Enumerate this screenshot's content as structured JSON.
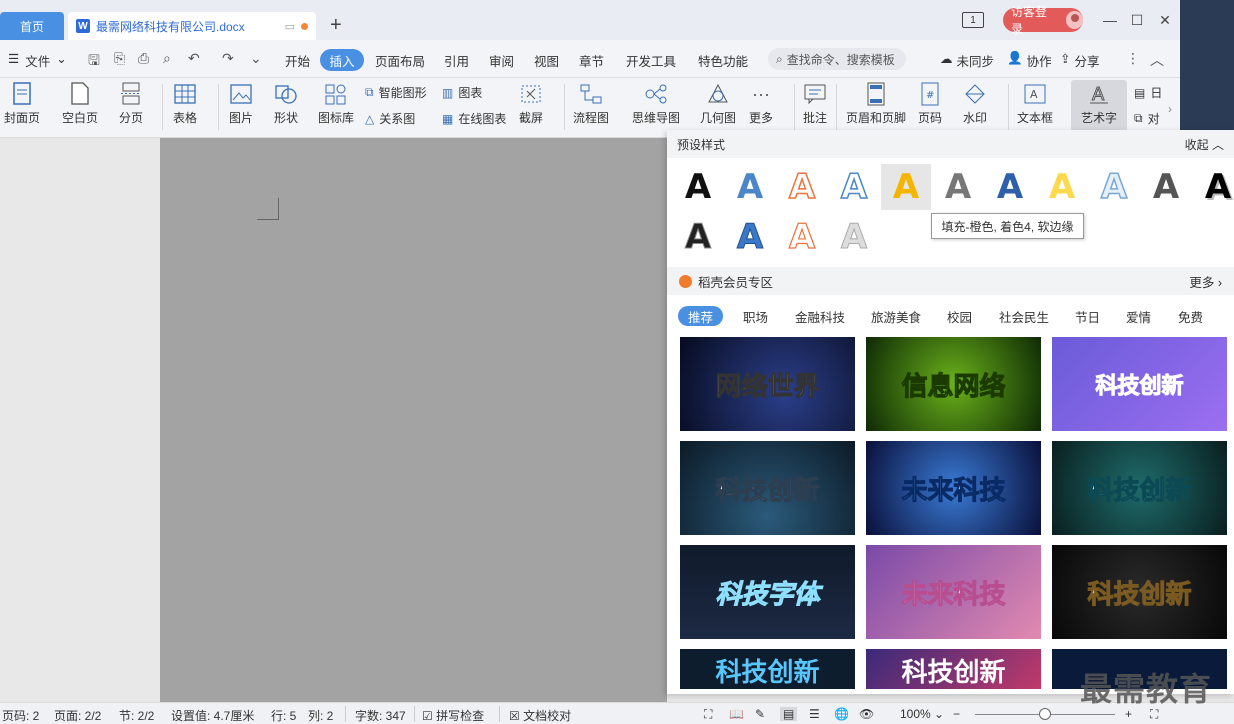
{
  "titlebar": {
    "home_tab": "首页",
    "doc_tab": "最需网络科技有限公司.docx",
    "page_badge": "1",
    "guest_login": "访客登录"
  },
  "menu": {
    "file": "文件",
    "tabs": [
      "开始",
      "插入",
      "页面布局",
      "引用",
      "审阅",
      "视图",
      "章节",
      "开发工具",
      "特色功能"
    ],
    "active_tab": "插入",
    "search_placeholder": "查找命令、搜索模板",
    "unsynced": "未同步",
    "collab": "协作",
    "share": "分享"
  },
  "ribbon": {
    "cover": "封面页",
    "blank": "空白页",
    "pagebreak": "分页",
    "table": "表格",
    "picture": "图片",
    "shape": "形状",
    "iconlib": "图标库",
    "smartart": "智能图形",
    "relation": "关系图",
    "chart": "图表",
    "online_chart": "在线图表",
    "screenshot": "截屏",
    "flowchart": "流程图",
    "mindmap": "思维导图",
    "geometry": "几何图",
    "more": "更多",
    "comment": "批注",
    "header_footer": "页眉和页脚",
    "page_number": "页码",
    "watermark": "水印",
    "textbox": "文本框",
    "wordart": "艺术字",
    "date": "日",
    "object": "对"
  },
  "panel": {
    "preset_title": "预设样式",
    "collapse": "收起",
    "tooltip": "填充-橙色, 着色4, 软边缘",
    "wordart_glyph": "A",
    "member_title": "稻壳会员专区",
    "more": "更多",
    "categories": [
      "推荐",
      "职场",
      "金融科技",
      "旅游美食",
      "校园",
      "社会民生",
      "节日",
      "爱情",
      "免费"
    ],
    "active_category": "推荐",
    "thumbs": [
      "网络世界",
      "信息网络",
      "科技创新",
      "科技创新",
      "未来科技",
      "科技创新",
      "科技字体",
      "未来科技",
      "科技创新",
      "科技创新",
      "科技创新",
      ""
    ]
  },
  "status": {
    "page_code": "页码: 2",
    "page": "页面: 2/2",
    "section": "节: 2/2",
    "setting": "设置值: 4.7厘米",
    "row": "行: 5",
    "col": "列: 2",
    "word_count": "字数: 347",
    "spell_check": "拼写检查",
    "doc_proof": "文档校对",
    "zoom": "100%"
  },
  "watermark_text": "最需教育",
  "colors": {
    "accent": "#4a90e2",
    "guest_button": "#e25a5a",
    "title_text": "#2f6bd8"
  }
}
